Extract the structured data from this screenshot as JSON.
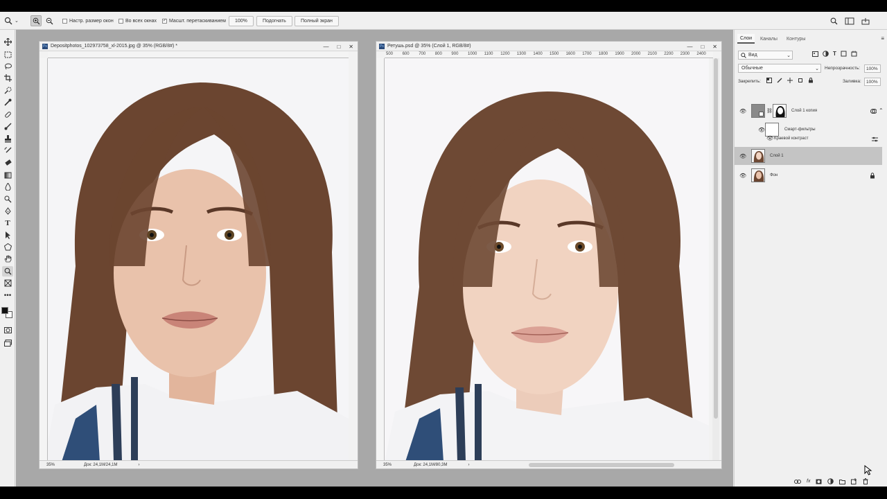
{
  "options_bar": {
    "resize_windows": "Настр. размер окон",
    "all_windows": "Во всех окнах",
    "scrubby_zoom": "Масшт. перетаскиванием",
    "zoom_value": "100%",
    "fit_button": "Подогнать",
    "fullscreen_button": "Полный экран"
  },
  "doc1": {
    "title": "Depositphotos_102973758_xl-2015.jpg @ 35% (RGB/8#) *",
    "zoom": "35%",
    "doc_size": "Док: 24,1M/24,1M"
  },
  "doc2": {
    "title": "Ретушь.psd @ 35% (Слой 1, RGB/8#)",
    "zoom": "35%",
    "doc_size": "Док: 24,1M/80,3M",
    "ruler_ticks": [
      "500",
      "600",
      "700",
      "800",
      "900",
      "1000",
      "1100",
      "1200",
      "1300",
      "1400",
      "1500",
      "1600",
      "1700",
      "1800",
      "1900",
      "2000",
      "2100",
      "2200",
      "2300",
      "2400"
    ]
  },
  "panel": {
    "tabs": [
      "Слои",
      "Каналы",
      "Контуры"
    ],
    "kind_filter": "Вид",
    "blend_mode": "Обычные",
    "opacity_label": "Непрозрачность:",
    "opacity_value": "100%",
    "lock_label": "Закрепить:",
    "fill_label": "Заливка:",
    "fill_value": "100%",
    "layers": [
      {
        "name": "Слой 1 копия"
      },
      {
        "name": "Смарт-фильтры"
      },
      {
        "name": "Краевой контраст"
      },
      {
        "name": "Слой 1"
      },
      {
        "name": "Фон"
      }
    ]
  },
  "colors": {
    "accent": "#2a4a7a",
    "selected_layer": "#c4c4c4",
    "hair": "#6b4530",
    "skin": "#e9c2ab"
  }
}
